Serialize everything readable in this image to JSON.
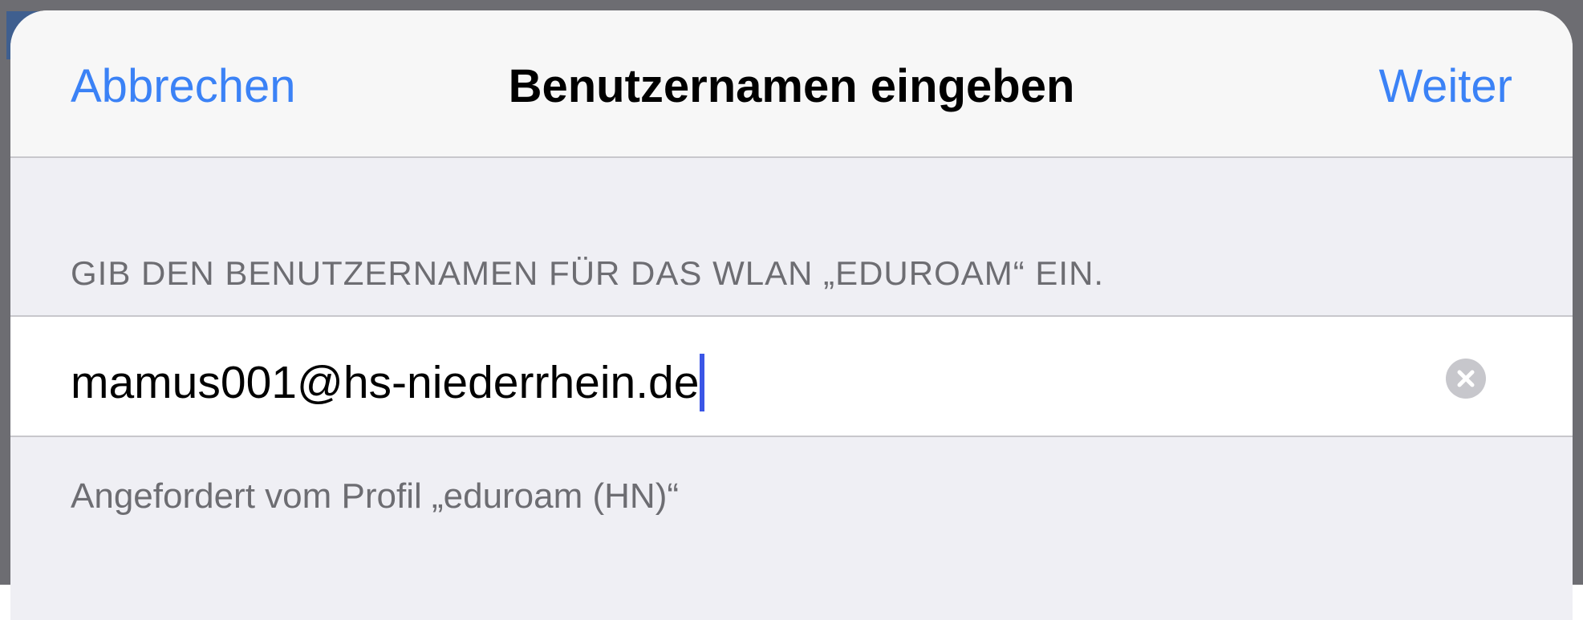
{
  "nav": {
    "cancel_label": "Abbrechen",
    "title": "Benutzernamen eingeben",
    "next_label": "Weiter"
  },
  "form": {
    "section_header": "GIB DEN BENUTZERNAMEN FÜR DAS WLAN „EDUROAM“ EIN.",
    "username_value": "mamus001@hs-niederrhein.de",
    "clear_icon": "clear-x-circle-icon",
    "footer": "Angefordert vom Profil „eduroam (HN)“"
  },
  "colors": {
    "accent": "#3b82f6",
    "caret": "#3b56e6",
    "sheet_background": "#efeff4",
    "secondary_text": "#6d6d72"
  }
}
